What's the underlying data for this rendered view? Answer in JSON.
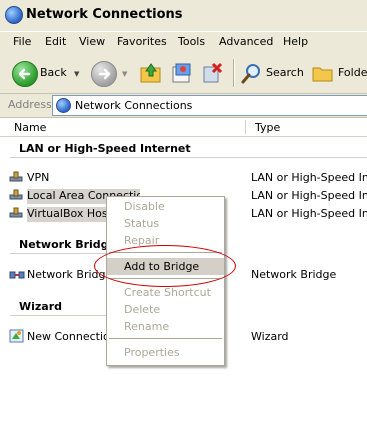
{
  "window": {
    "title": "Network Connections"
  },
  "menu": [
    "File",
    "Edit",
    "View",
    "Favorites",
    "Tools",
    "Advanced",
    "Help"
  ],
  "toolbar": {
    "back_label": "Back",
    "search_label": "Search",
    "folders_label": "Folder"
  },
  "address": {
    "label": "Address",
    "value": "Network Connections"
  },
  "columns": {
    "name": "Name",
    "type": "Type"
  },
  "groups": {
    "lan": "LAN or High-Speed Internet",
    "bridge": "Network Bridge",
    "wizard": "Wizard"
  },
  "items": {
    "vpn": {
      "name": "VPN",
      "type": "LAN or High-Speed Inter"
    },
    "lac": {
      "name": "Local Area Connection",
      "type": "LAN or High-Speed Inter"
    },
    "vbox": {
      "name": "VirtualBox Host I",
      "type": "LAN or High-Speed Inter"
    },
    "bridge": {
      "name": "Network Bridge",
      "type": "Network Bridge"
    },
    "newconn": {
      "name": "New Connection",
      "type": "Wizard"
    }
  },
  "context_menu": {
    "disable": "Disable",
    "status": "Status",
    "repair": "Repair",
    "add_to_bridge": "Add to Bridge",
    "create_shortcut": "Create Shortcut",
    "delete": "Delete",
    "rename": "Rename",
    "properties": "Properties"
  },
  "colors": {
    "annotation": "#cc0000",
    "highlight": "#d4d0c8"
  },
  "icons": [
    "network-connections-icon",
    "back-arrow-icon",
    "forward-arrow-icon",
    "up-folder-icon",
    "move-to-icon",
    "delete-icon",
    "search-icon",
    "folders-icon",
    "network-adapter-icon",
    "network-bridge-icon",
    "new-connection-icon"
  ]
}
